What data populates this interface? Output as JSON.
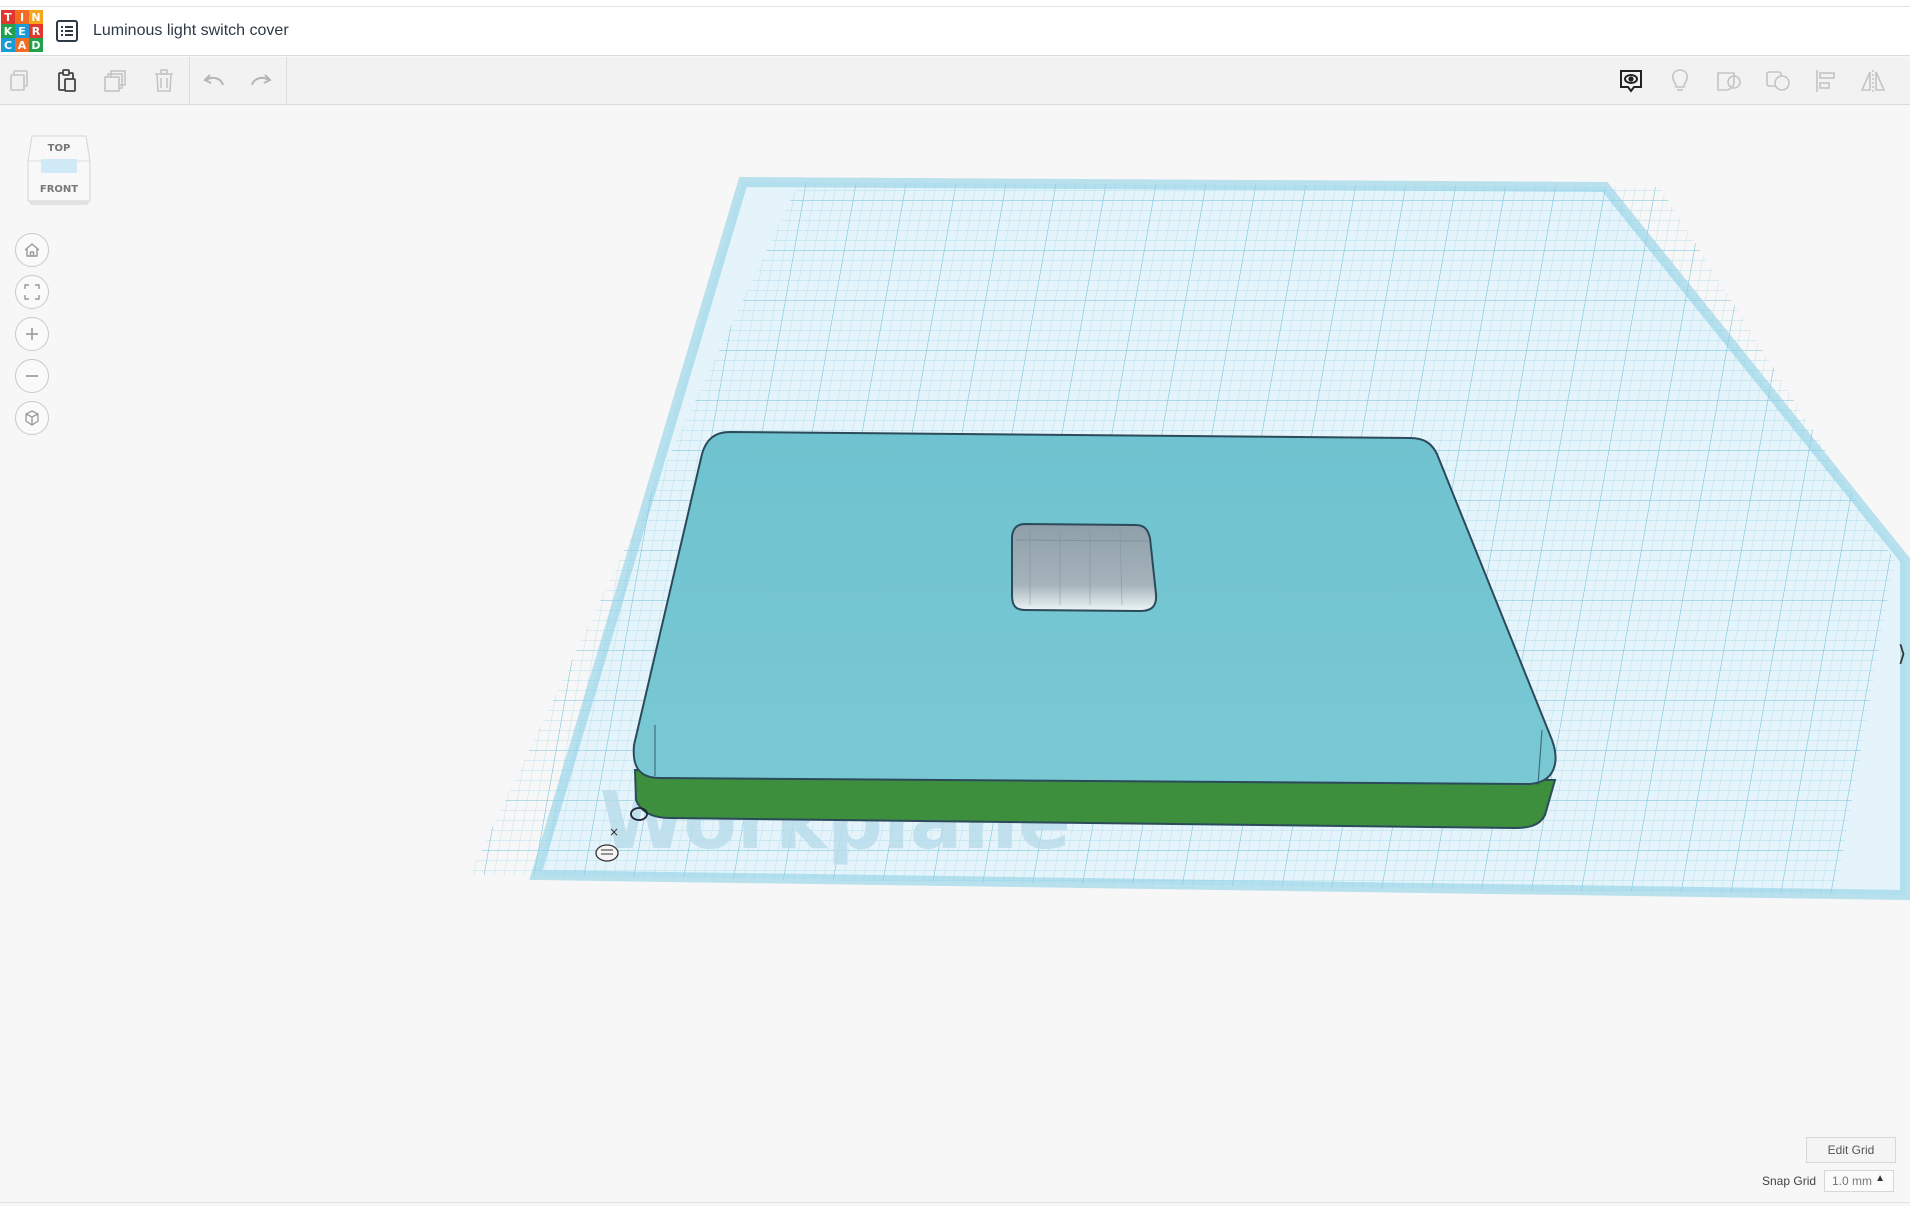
{
  "app": {
    "logo_letters": [
      "T",
      "I",
      "N",
      "K",
      "E",
      "R",
      "C",
      "A",
      "D"
    ],
    "logo_colors": [
      "#e2372c",
      "#f36c24",
      "#f7a51c",
      "#1fa24b",
      "#1a9ad6",
      "#e2372c",
      "#1a9ad6",
      "#f36c24",
      "#1fa24b"
    ]
  },
  "header": {
    "title": "Luminous light switch cover"
  },
  "toolbar": {
    "left": [
      "copy-icon",
      "paste-icon",
      "duplicate-icon",
      "delete-icon",
      "undo-icon",
      "redo-icon"
    ],
    "right": [
      "notes-icon",
      "light-bulb-icon",
      "group-icon",
      "ungroup-icon",
      "align-icon",
      "mirror-icon"
    ]
  },
  "viewcube": {
    "top_label": "TOP",
    "front_label": "FRONT"
  },
  "nav_controls": [
    "home-icon",
    "fit-icon",
    "zoom-in-icon",
    "zoom-out-icon",
    "perspective-icon"
  ],
  "workplane": {
    "label": "Workplane",
    "grid_color": "#7cc8e0",
    "fill_color": "#e6f5fb"
  },
  "model": {
    "top_color": "#72c3cf",
    "side_color": "#3d8f3d",
    "edge_color": "#2b4a5a"
  },
  "footer": {
    "edit_grid_label": "Edit Grid",
    "snap_grid_label": "Snap Grid",
    "snap_grid_value": "1.0 mm"
  }
}
